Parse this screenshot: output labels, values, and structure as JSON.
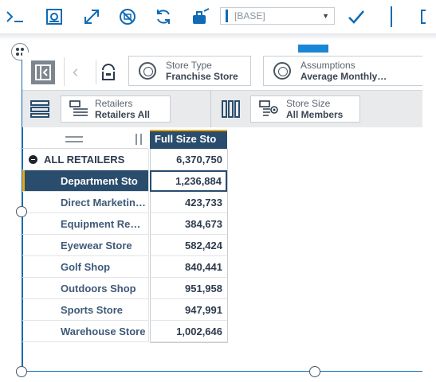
{
  "toolbar": {
    "buttons": [
      {
        "name": "console-icon",
        "glyph": ">_"
      },
      {
        "name": "save-view-icon"
      },
      {
        "name": "expand-icon"
      },
      {
        "name": "disable-icon"
      },
      {
        "name": "refresh-icon"
      },
      {
        "name": "sandbox-icon"
      }
    ],
    "base_selector": {
      "value": "[BASE]",
      "caret": "▼"
    },
    "commit_icon": "checkmark-icon"
  },
  "context": {
    "chips": [
      {
        "title": "Store Type",
        "value": "Franchise Store"
      },
      {
        "title": "Assumptions",
        "value": "Average Monthly…"
      }
    ]
  },
  "dimensions": {
    "rows": {
      "title": "Retailers",
      "value": "Retailers All"
    },
    "columns": {
      "title": "Store Size",
      "value": "Store Size"
    },
    "columns_value": "All Members"
  },
  "grid": {
    "column_header": "Full Size Sto",
    "rows": [
      {
        "label": "ALL RETAILERS",
        "value": "6,370,750"
      },
      {
        "label": "Department Sto",
        "value": "1,236,884"
      },
      {
        "label": "Direct Marketing Channel",
        "value": "423,733"
      },
      {
        "label": "Equipment Rental Store",
        "value": "384,673"
      },
      {
        "label": "Eyewear Store",
        "value": "582,424"
      },
      {
        "label": "Golf Shop",
        "value": "840,441"
      },
      {
        "label": "Outdoors Shop",
        "value": "951,958"
      },
      {
        "label": "Sports Store",
        "value": "947,991"
      },
      {
        "label": "Warehouse Store",
        "value": "1,002,646"
      }
    ]
  },
  "colors": {
    "accent": "#0f6bb5",
    "header": "#2a4d6e",
    "highlight": "#e6a817"
  }
}
